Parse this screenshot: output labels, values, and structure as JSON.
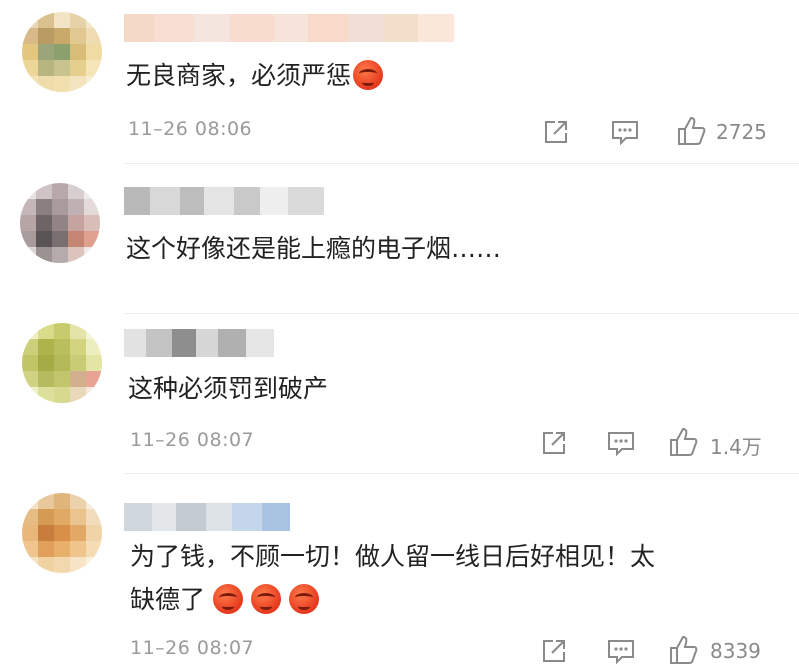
{
  "comments": [
    {
      "text": "无良商家，必须严惩",
      "emoji_count": 1,
      "time": "11–26 08:06",
      "likes": "2725",
      "actions": [
        "share-icon",
        "comment-icon",
        "like-icon"
      ]
    },
    {
      "text": "这个好像还是能上瘾的电子烟……",
      "emoji_count": 0,
      "time": "",
      "likes": ""
    },
    {
      "text": "这种必须罚到破产",
      "emoji_count": 0,
      "time": "11–26 08:07",
      "likes": "1.4万",
      "actions": [
        "share-icon",
        "comment-icon",
        "like-icon"
      ]
    },
    {
      "text_line1": "为了钱，不顾一切！做人留一线日后好相见！太",
      "text_line2": "缺德了",
      "emoji_count": 3,
      "time": "11–26 08:07",
      "likes": "8339",
      "actions": [
        "share-icon",
        "comment-icon",
        "like-icon"
      ]
    }
  ],
  "colors": {
    "text": "#222222",
    "meta": "#9a9a9a",
    "divider": "#ececec",
    "emoji": "#e5381c"
  }
}
